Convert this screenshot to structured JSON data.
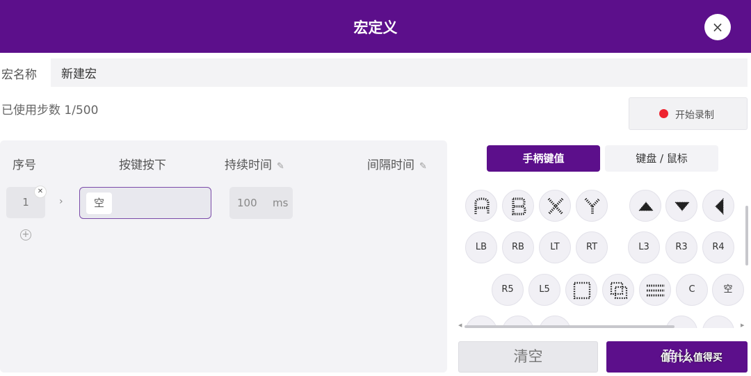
{
  "dialog": {
    "title": "宏定义",
    "close_icon": "×"
  },
  "macro_name": {
    "label": "宏名称",
    "value": "新建宏"
  },
  "steps": {
    "text": "已使用步数 1/500"
  },
  "record_button": {
    "label": "开始录制",
    "dot_color": "#ee2430"
  },
  "table": {
    "headers": {
      "index": "序号",
      "key_press": "按键按下",
      "duration": "持续时间",
      "interval": "间隔时间"
    },
    "rows": [
      {
        "index": "1",
        "key": "空",
        "duration_value": "100",
        "duration_unit": "ms"
      }
    ]
  },
  "tabs": [
    {
      "label": "手柄键值",
      "active": true
    },
    {
      "label": "键盘 / 鼠标",
      "active": false
    }
  ],
  "gamepad_keys": {
    "row1": [
      "A",
      "B",
      "X",
      "Y",
      "dpad-up-icon",
      "dpad-down-icon",
      "dpad-left-icon"
    ],
    "row2": [
      "LB",
      "RB",
      "LT",
      "RT",
      "L3",
      "R3",
      "R4"
    ],
    "row3": [
      "R5",
      "L5",
      "view-icon",
      "share-icon",
      "menu-icon",
      "C",
      "空"
    ]
  },
  "actions": {
    "clear_label": "清空",
    "confirm_label": "确认"
  },
  "watermark": "值 什么值得买",
  "colors": {
    "brand": "#5c0f8b",
    "record_dot": "#ee2430"
  }
}
